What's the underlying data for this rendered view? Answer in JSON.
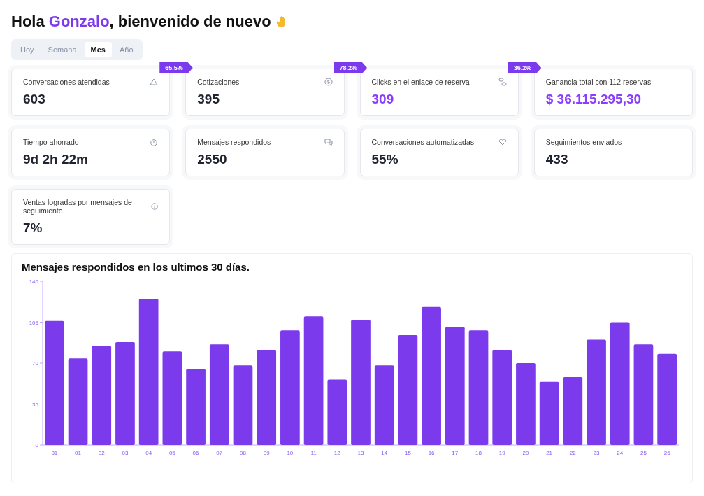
{
  "greeting": {
    "prefix": "Hola ",
    "name": "Gonzalo",
    "suffix": ", bienvenido de nuevo"
  },
  "periods": [
    {
      "label": "Hoy",
      "selected": false
    },
    {
      "label": "Semana",
      "selected": false
    },
    {
      "label": "Mes",
      "selected": true
    },
    {
      "label": "Año",
      "selected": false
    }
  ],
  "stats": [
    {
      "label": "Conversaciones atendidas",
      "value": "603",
      "kind": "chart",
      "highlight": false
    },
    {
      "label": "Cotizaciones",
      "value": "395",
      "kind": "dollar",
      "highlight": false,
      "badge": "65.5%"
    },
    {
      "label": "Clicks en el enlace de reserva",
      "value": "309",
      "kind": "link",
      "highlight": true,
      "badge": "78.2%"
    },
    {
      "label": "Ganancia total con 112 reservas",
      "value": "$ 36.115.295,30",
      "kind": "plain",
      "highlight": true,
      "badge": "36.2%"
    },
    {
      "label": "Tiempo ahorrado",
      "value": "9d 2h 22m",
      "kind": "clock",
      "highlight": false
    },
    {
      "label": "Mensajes respondidos",
      "value": "2550",
      "kind": "chat",
      "highlight": false
    },
    {
      "label": "Conversaciones automatizadas",
      "value": "55%",
      "kind": "heart",
      "highlight": false
    },
    {
      "label": "Seguimientos enviados",
      "value": "433",
      "kind": "plain",
      "highlight": false
    },
    {
      "label": "Ventas logradas por mensajes de seguimiento",
      "value": "7%",
      "kind": "info",
      "highlight": false
    }
  ],
  "chart": {
    "title": "Mensajes respondidos en los ultimos 30 días.",
    "chart_data": {
      "type": "bar",
      "categories": [
        "31",
        "01",
        "02",
        "03",
        "04",
        "05",
        "06",
        "07",
        "08",
        "09",
        "10",
        "11",
        "12",
        "13",
        "14",
        "15",
        "16",
        "17",
        "18",
        "19",
        "20",
        "21",
        "22",
        "23",
        "24",
        "25",
        "26"
      ],
      "series": [
        {
          "color": "#7c3aed",
          "values": [
            106,
            74,
            85,
            88,
            125,
            80,
            65,
            86,
            68,
            81,
            98,
            110,
            56,
            107,
            68,
            94,
            118,
            101,
            98,
            81,
            70,
            54,
            58,
            90,
            105,
            86,
            78
          ]
        }
      ],
      "ylim": [
        0,
        140
      ],
      "yticks": [
        0,
        35,
        70,
        105,
        140
      ]
    }
  }
}
